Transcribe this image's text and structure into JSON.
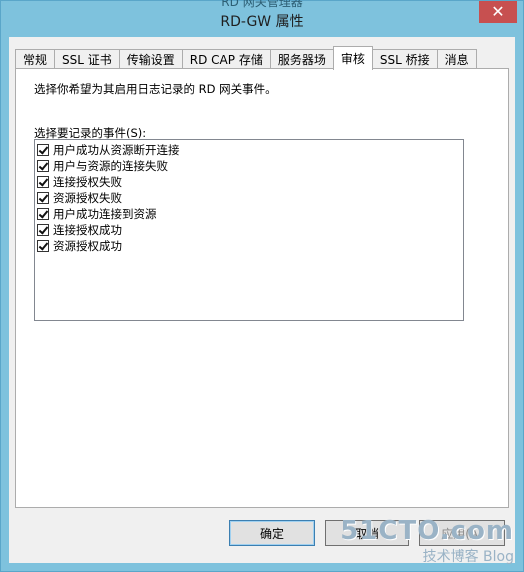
{
  "window": {
    "ghost_title": "RD 网关管理器",
    "title": "RD-GW 属性",
    "close_glyph": "✕"
  },
  "tabs": [
    {
      "label": "常规",
      "active": false
    },
    {
      "label": "SSL 证书",
      "active": false
    },
    {
      "label": "传输设置",
      "active": false
    },
    {
      "label": "RD CAP 存储",
      "active": false
    },
    {
      "label": "服务器场",
      "active": false
    },
    {
      "label": "审核",
      "active": true
    },
    {
      "label": "SSL 桥接",
      "active": false
    },
    {
      "label": "消息",
      "active": false
    }
  ],
  "audit": {
    "description": "选择你希望为其启用日志记录的 RD 网关事件。",
    "list_label": "选择要记录的事件(S):",
    "events": [
      {
        "label": "用户成功从资源断开连接",
        "checked": true
      },
      {
        "label": "用户与资源的连接失败",
        "checked": true
      },
      {
        "label": "连接授权失败",
        "checked": true
      },
      {
        "label": "资源授权失败",
        "checked": true
      },
      {
        "label": "用户成功连接到资源",
        "checked": true
      },
      {
        "label": "连接授权成功",
        "checked": true
      },
      {
        "label": "资源授权成功",
        "checked": true
      }
    ]
  },
  "buttons": {
    "ok": "确定",
    "cancel": "取消",
    "apply": "应用(A)"
  },
  "watermark": {
    "main": "51CTO.com",
    "sub": "技术博客  Blog"
  }
}
